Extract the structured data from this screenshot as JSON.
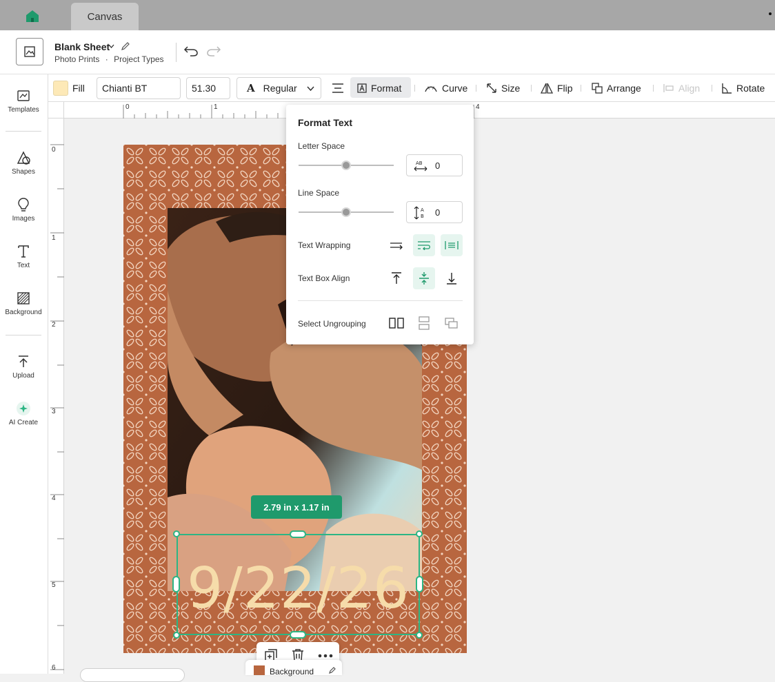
{
  "tabs": {
    "active": "Canvas"
  },
  "header": {
    "title": "Blank Sheet",
    "crumb1": "Photo Prints",
    "crumb_sep": "·",
    "crumb2": "Project Types"
  },
  "toolbar": {
    "fill_label": "Fill",
    "fill_color": "#fde9b7",
    "font_family": "Chianti BT",
    "font_size": "51.30",
    "font_style": "Regular",
    "format_label": "Format",
    "curve_label": "Curve",
    "size_label": "Size",
    "flip_label": "Flip",
    "arrange_label": "Arrange",
    "align_label": "Align",
    "rotate_label": "Rotate"
  },
  "sidebar": {
    "items": [
      {
        "label": "Templates"
      },
      {
        "label": "Shapes"
      },
      {
        "label": "Images"
      },
      {
        "label": "Text"
      },
      {
        "label": "Background"
      },
      {
        "label": "Upload"
      },
      {
        "label": "AI Create"
      }
    ]
  },
  "rulers": {
    "h": [
      "0",
      "1",
      "4"
    ],
    "v": [
      "0",
      "1",
      "2",
      "3",
      "4",
      "5",
      "6"
    ]
  },
  "canvas": {
    "date_text": "9/22/26",
    "dimensions": "2.79  in x 1.17  in",
    "layer_tag": "Background"
  },
  "format_popup": {
    "title": "Format Text",
    "letter_space_label": "Letter Space",
    "letter_space_value": "0",
    "line_space_label": "Line Space",
    "line_space_value": "0",
    "text_wrapping_label": "Text Wrapping",
    "text_box_align_label": "Text Box Align",
    "select_ungrouping_label": "Select Ungrouping"
  },
  "colors": {
    "accent": "#2cb584",
    "artboard": "#b8663f",
    "text_fill": "#f6dcaa"
  }
}
